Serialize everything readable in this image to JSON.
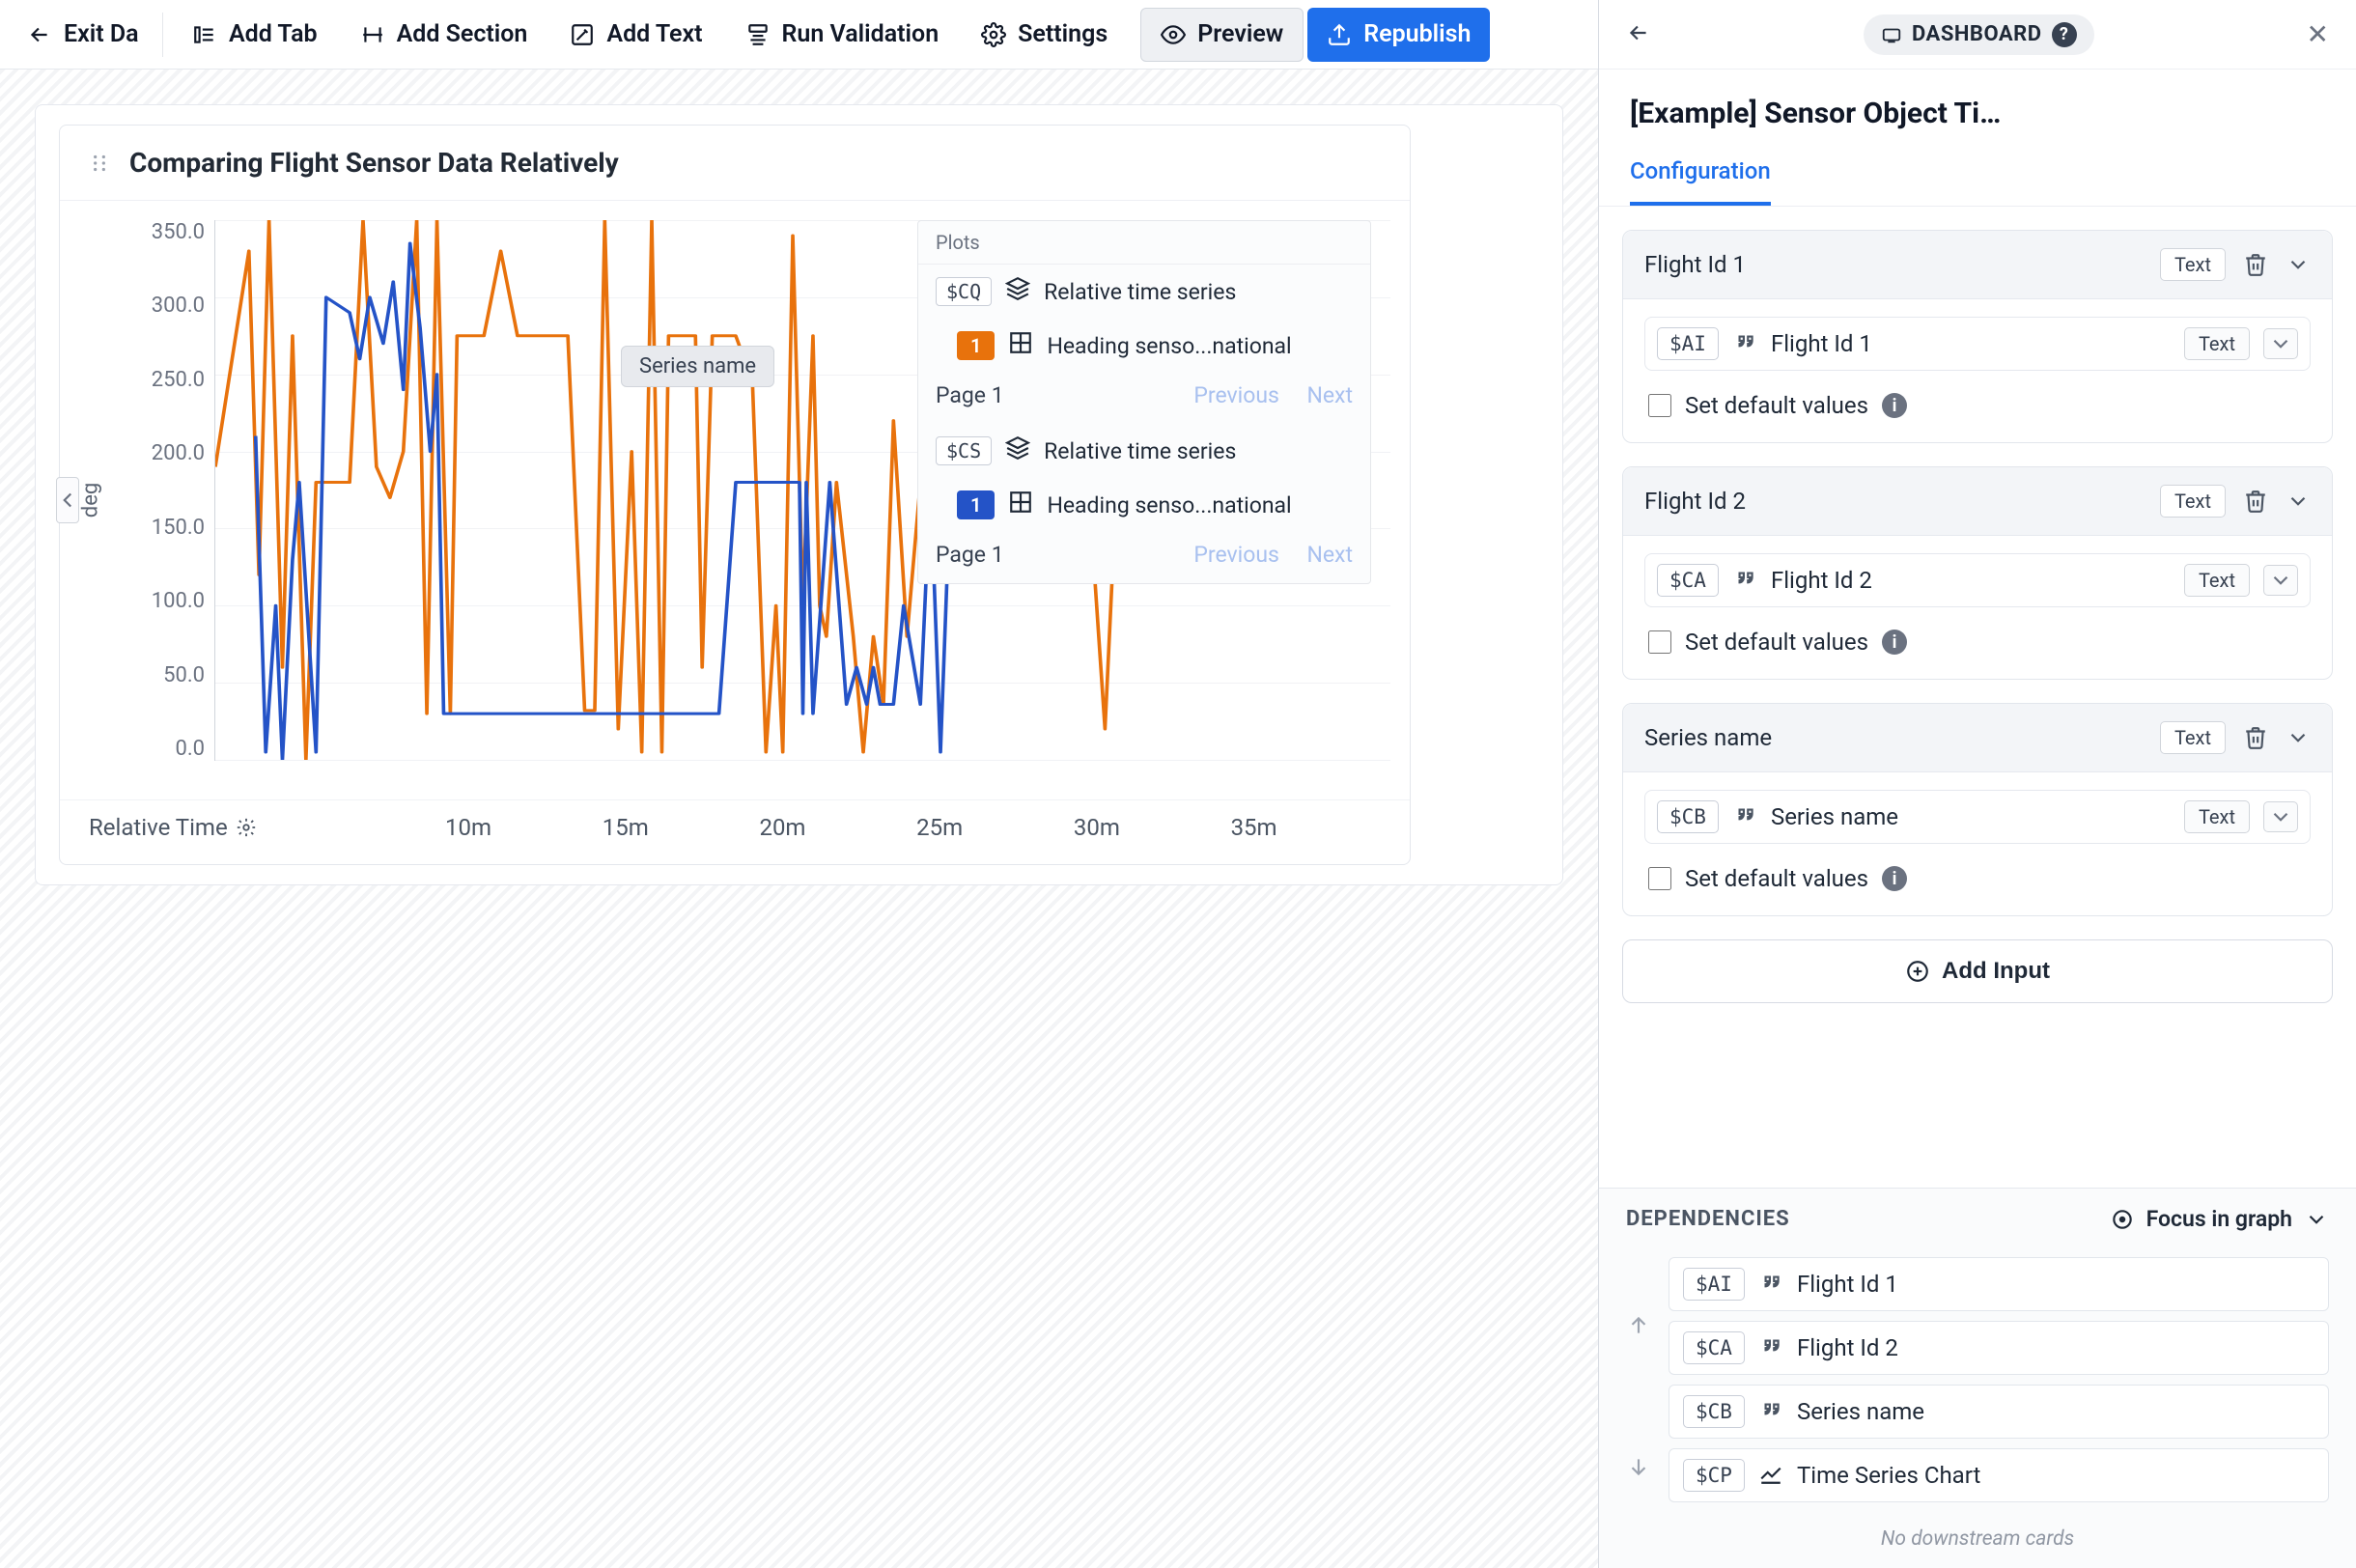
{
  "toolbar": {
    "exit": "Exit Da",
    "add_tab": "Add Tab",
    "add_section": "Add Section",
    "add_text": "Add Text",
    "run_validation": "Run Validation",
    "settings": "Settings",
    "preview": "Preview",
    "republish": "Republish"
  },
  "chart": {
    "title": "Comparing Flight Sensor Data Relatively",
    "x_label": "Relative Time",
    "y_label": "deg",
    "tooltip": "Series name"
  },
  "chart_data": {
    "type": "line",
    "ylabel": "deg",
    "xlabel": "Relative Time",
    "ylim": [
      0,
      350
    ],
    "y_ticks": [
      "350.0",
      "300.0",
      "250.0",
      "200.0",
      "150.0",
      "100.0",
      "50.0",
      "0.0"
    ],
    "x_ticks": [
      "10m",
      "15m",
      "20m",
      "25m",
      "30m",
      "35m"
    ],
    "x_range_min": 5,
    "series": [
      {
        "name": "Heading senso...national",
        "color": "#e8720c",
        "points": [
          [
            5,
            190
          ],
          [
            6,
            330
          ],
          [
            6.3,
            120
          ],
          [
            6.6,
            350
          ],
          [
            7,
            60
          ],
          [
            7.3,
            275
          ],
          [
            7.7,
            0
          ],
          [
            8,
            180
          ],
          [
            8.4,
            180
          ],
          [
            9,
            180
          ],
          [
            9.4,
            350
          ],
          [
            9.8,
            190
          ],
          [
            10.2,
            170
          ],
          [
            10.6,
            200
          ],
          [
            11,
            350
          ],
          [
            11.3,
            30
          ],
          [
            11.6,
            350
          ],
          [
            12,
            30
          ],
          [
            12.2,
            275
          ],
          [
            13,
            275
          ],
          [
            13.5,
            330
          ],
          [
            14,
            275
          ],
          [
            15.5,
            275
          ],
          [
            16,
            32
          ],
          [
            16.3,
            32
          ],
          [
            16.6,
            350
          ],
          [
            17,
            20
          ],
          [
            17.4,
            200
          ],
          [
            17.7,
            5
          ],
          [
            18,
            350
          ],
          [
            18.3,
            5
          ],
          [
            18.5,
            275
          ],
          [
            19,
            275
          ],
          [
            19.3,
            275
          ],
          [
            19.5,
            60
          ],
          [
            19.8,
            275
          ],
          [
            20.5,
            275
          ],
          [
            21,
            245
          ],
          [
            21.4,
            5
          ],
          [
            21.7,
            100
          ],
          [
            21.9,
            5
          ],
          [
            22.2,
            340
          ],
          [
            22.5,
            100
          ],
          [
            22.8,
            275
          ],
          [
            23,
            100
          ],
          [
            23.2,
            80
          ],
          [
            23.5,
            180
          ],
          [
            24,
            80
          ],
          [
            24.3,
            5
          ],
          [
            24.6,
            80
          ],
          [
            24.9,
            36
          ],
          [
            25.2,
            220
          ],
          [
            25.6,
            80
          ],
          [
            26,
            180
          ],
          [
            28,
            180
          ],
          [
            29,
            180
          ],
          [
            31,
            180
          ],
          [
            31.5,
            20
          ],
          [
            32,
            250
          ],
          [
            34,
            260
          ],
          [
            35,
            310
          ]
        ]
      },
      {
        "name": "Heading senso...national",
        "color": "#2453c7",
        "points": [
          [
            6.2,
            210
          ],
          [
            6.5,
            5
          ],
          [
            6.8,
            100
          ],
          [
            7.0,
            0
          ],
          [
            7.3,
            130
          ],
          [
            7.5,
            180
          ],
          [
            8,
            5
          ],
          [
            8.3,
            300
          ],
          [
            9,
            290
          ],
          [
            9.3,
            260
          ],
          [
            9.6,
            300
          ],
          [
            10,
            270
          ],
          [
            10.3,
            310
          ],
          [
            10.6,
            240
          ],
          [
            10.8,
            335
          ],
          [
            11.1,
            280
          ],
          [
            11.4,
            200
          ],
          [
            11.6,
            250
          ],
          [
            11.8,
            30
          ],
          [
            18.5,
            30
          ],
          [
            18.7,
            30
          ],
          [
            20,
            30
          ],
          [
            20.5,
            180
          ],
          [
            22.4,
            180
          ],
          [
            22.5,
            30
          ],
          [
            22.6,
            180
          ],
          [
            22.8,
            30
          ],
          [
            23.3,
            180
          ],
          [
            23.8,
            36
          ],
          [
            24.1,
            60
          ],
          [
            24.4,
            36
          ],
          [
            24.6,
            60
          ],
          [
            24.8,
            36
          ],
          [
            25.2,
            36
          ],
          [
            25.5,
            100
          ],
          [
            26,
            36
          ],
          [
            26.3,
            180
          ],
          [
            26.6,
            5
          ],
          [
            26.9,
            180
          ]
        ]
      }
    ]
  },
  "legend": {
    "header": "Plots",
    "groups": [
      {
        "chip": "$CQ",
        "type": "Relative time series",
        "badge": "1",
        "badge_color": "orange",
        "series": "Heading senso...national",
        "page": "Page 1",
        "prev": "Previous",
        "next": "Next"
      },
      {
        "chip": "$CS",
        "type": "Relative time series",
        "badge": "1",
        "badge_color": "blue",
        "series": "Heading senso...national",
        "page": "Page 1",
        "prev": "Previous",
        "next": "Next"
      }
    ]
  },
  "sidebar": {
    "chip": "DASHBOARD",
    "title": "[Example] Sensor Object Ti…",
    "tab_config": "Configuration",
    "cards": [
      {
        "title": "Flight Id 1",
        "type": "Text",
        "chip": "$AI",
        "label": "Flight Id 1",
        "rowtype": "Text",
        "defaults": "Set default values"
      },
      {
        "title": "Flight Id 2",
        "type": "Text",
        "chip": "$CA",
        "label": "Flight Id 2",
        "rowtype": "Text",
        "defaults": "Set default values"
      },
      {
        "title": "Series name",
        "type": "Text",
        "chip": "$CB",
        "label": "Series name",
        "rowtype": "Text",
        "defaults": "Set default values"
      }
    ],
    "add_input": "Add Input"
  },
  "deps": {
    "header": "DEPENDENCIES",
    "focus": "Focus in graph",
    "footer": "No downstream cards",
    "items": [
      {
        "chip": "$AI",
        "icon": "quotes",
        "label": "Flight Id 1"
      },
      {
        "chip": "$CA",
        "icon": "quotes",
        "label": "Flight Id 2"
      },
      {
        "chip": "$CB",
        "icon": "quotes",
        "label": "Series name"
      },
      {
        "chip": "$CP",
        "icon": "chart",
        "label": "Time Series Chart"
      }
    ]
  }
}
